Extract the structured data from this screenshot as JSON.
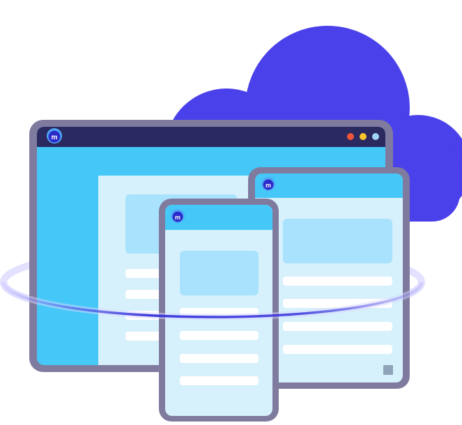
{
  "logo": {
    "mark": "m",
    "icon": "cloud-m-logo-icon"
  },
  "colors": {
    "cloud": "#4b41ea",
    "device_frame": "#7f7b9f",
    "desktop_titlebar": "#2b2a60",
    "screen_blue": "#45c8f8",
    "content_panel": "#d6f0fc",
    "content_block": "#a8e2fc",
    "content_line": "#ffffff",
    "orbit_ring": "#2a28d8",
    "window_dot_red": "#f0553a",
    "window_dot_yellow": "#f8c52a",
    "window_dot_blue": "#9ed6f3"
  }
}
